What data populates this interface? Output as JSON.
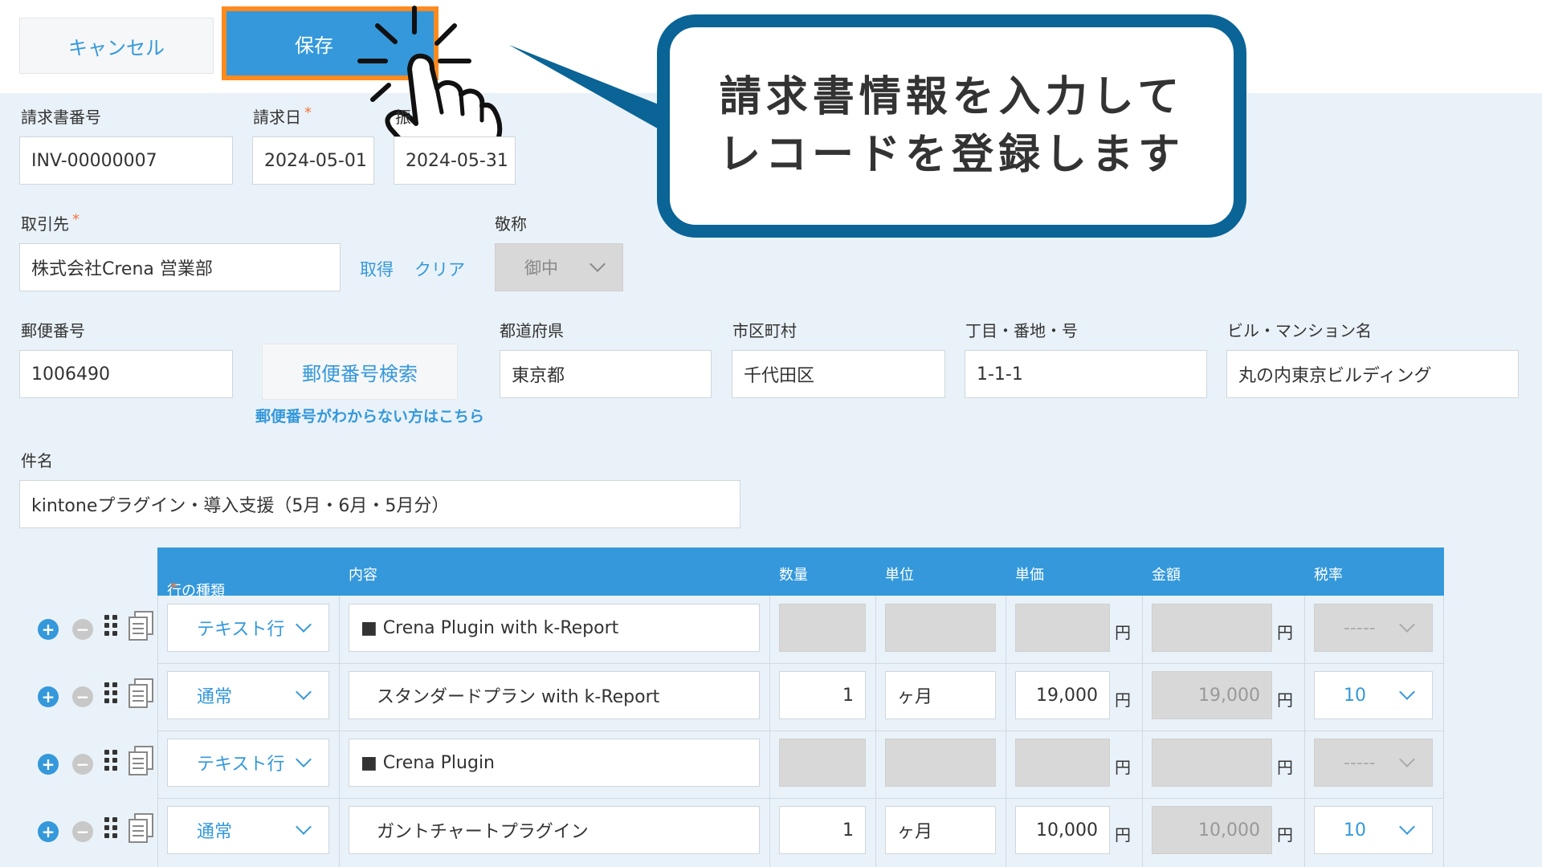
{
  "toolbar": {
    "cancel_label": "キャンセル",
    "save_label": "保存"
  },
  "callout": {
    "line1": "請求書情報を入力して",
    "line2": "レコードを登録します"
  },
  "form": {
    "invoice_no_label": "請求書番号",
    "invoice_no": "INV-00000007",
    "invoice_date_label": "請求日",
    "invoice_date": "2024-05-01",
    "transfer_label": "振",
    "transfer_date": "2024-05-31",
    "client_label": "取引先",
    "client": "株式会社Crena 営業部",
    "fetch_label": "取得",
    "clear_label": "クリア",
    "honorific_label": "敬称",
    "honorific": "御中",
    "zip_label": "郵便番号",
    "zip": "1006490",
    "zip_search_label": "郵便番号検索",
    "zip_help": "郵便番号がわからない方はこちら",
    "pref_label": "都道府県",
    "pref": "東京都",
    "city_label": "市区町村",
    "city": "千代田区",
    "street_label": "丁目・番地・号",
    "street": "1-1-1",
    "building_label": "ビル・マンション名",
    "building": "丸の内東京ビルディング",
    "subject_label": "件名",
    "subject": "kintoneプラグイン・導入支援（5月・6月・5月分）"
  },
  "table": {
    "headers": {
      "type": "行の種類",
      "content": "内容",
      "qty": "数量",
      "unit": "単位",
      "price": "単価",
      "amount": "金額",
      "tax": "税率"
    },
    "yen": "円",
    "rows": [
      {
        "type": "テキスト行",
        "content": "■ Crena Plugin with k-Report",
        "qty": "",
        "unit": "",
        "price": "",
        "amount": "",
        "tax": "-----"
      },
      {
        "type": "通常",
        "content": "スタンダードプラン with k-Report",
        "qty": "1",
        "unit": "ヶ月",
        "price": "19,000",
        "amount": "19,000",
        "tax": "10"
      },
      {
        "type": "テキスト行",
        "content": "■ Crena Plugin",
        "qty": "",
        "unit": "",
        "price": "",
        "amount": "",
        "tax": "-----"
      },
      {
        "type": "通常",
        "content": "ガントチャートプラグイン",
        "qty": "1",
        "unit": "ヶ月",
        "price": "10,000",
        "amount": "10,000",
        "tax": "10"
      }
    ]
  },
  "colors": {
    "accent": "#3498db",
    "highlight": "#ff8a1e",
    "callout_border": "#0a6496"
  }
}
